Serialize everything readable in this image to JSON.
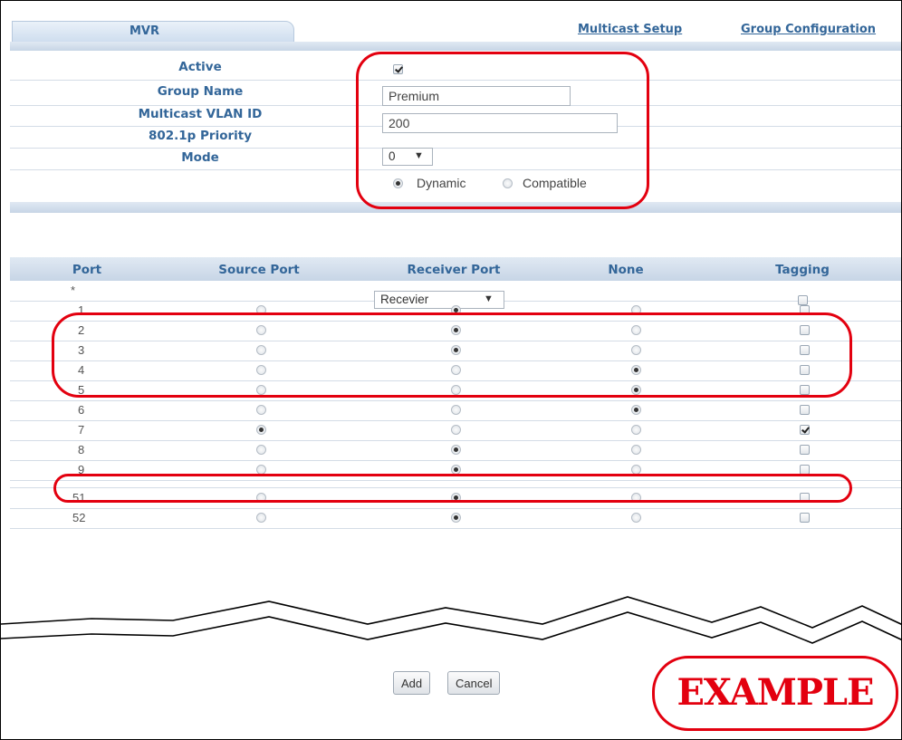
{
  "tabs": {
    "active": "MVR",
    "links": [
      "Multicast Setup",
      "Group Configuration"
    ]
  },
  "form": {
    "active_label": "Active",
    "active_checked": true,
    "group_name_label": "Group Name",
    "group_name_value": "Premium",
    "vlan_label": "Multicast VLAN ID",
    "vlan_value": "200",
    "priority_label": "802.1p Priority",
    "priority_value": "0",
    "mode_label": "Mode",
    "mode_options": [
      "Dynamic",
      "Compatible"
    ],
    "mode_selected": "Dynamic"
  },
  "table": {
    "columns": [
      "Port",
      "Source Port",
      "Receiver Port",
      "None",
      "Tagging"
    ],
    "wildcard_port": "*",
    "wildcard_select": "Recevier",
    "rows": [
      {
        "port": "1",
        "mode": "receiver",
        "tagging": false
      },
      {
        "port": "2",
        "mode": "receiver",
        "tagging": false
      },
      {
        "port": "3",
        "mode": "receiver",
        "tagging": false
      },
      {
        "port": "4",
        "mode": "none",
        "tagging": false
      },
      {
        "port": "5",
        "mode": "none",
        "tagging": false
      },
      {
        "port": "6",
        "mode": "none",
        "tagging": false
      },
      {
        "port": "7",
        "mode": "source",
        "tagging": true
      },
      {
        "port": "8",
        "mode": "receiver",
        "tagging": false
      },
      {
        "port": "9",
        "mode": "receiver",
        "tagging": false
      },
      {
        "port": "51",
        "mode": "receiver",
        "tagging": false
      },
      {
        "port": "52",
        "mode": "receiver",
        "tagging": false
      }
    ]
  },
  "buttons": {
    "add": "Add",
    "cancel": "Cancel"
  },
  "stamp": "EXAMPLE",
  "colors": {
    "label_blue": "#336699",
    "callout_red": "#e3000f"
  }
}
